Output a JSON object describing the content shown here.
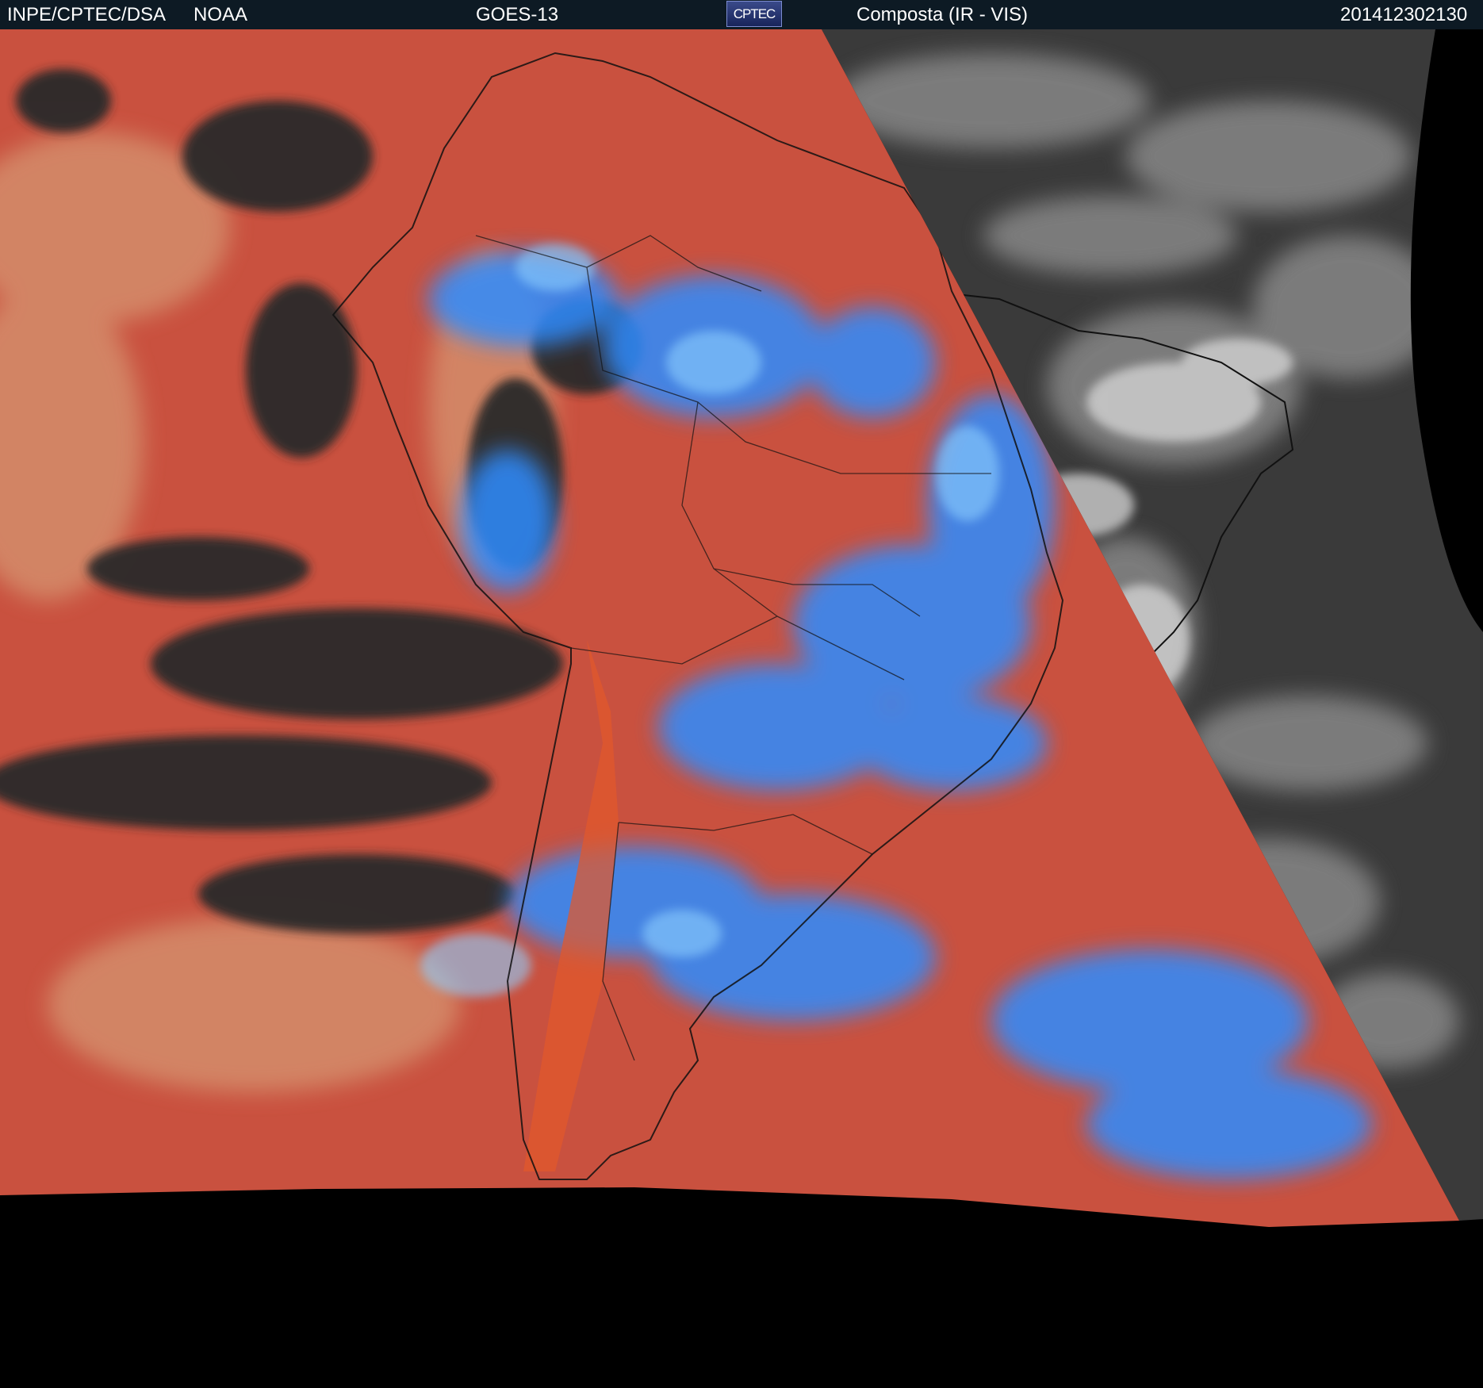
{
  "header": {
    "institution": "INPE/CPTEC/DSA",
    "agency": "NOAA",
    "satellite": "GOES-13",
    "logo_text": "CPTEC",
    "product": "Composta (IR - VIS)",
    "timestamp": "201412302130"
  },
  "palette": {
    "header_bg": "#0d1a24",
    "ir_warm": "#c9513f",
    "ir_cold_cloud": "#2f8cff",
    "ir_mid_cloud": "#7aa3c8",
    "ir_clear": "#2a2a2a",
    "vis_bg": "#3a3a3a",
    "vis_cloud": "#d8d8d8",
    "space": "#000000"
  }
}
